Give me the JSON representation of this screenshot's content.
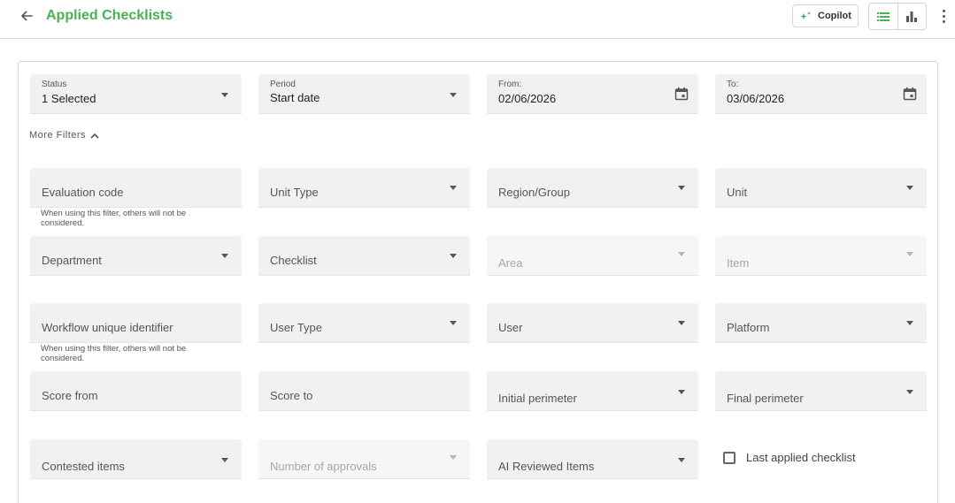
{
  "header": {
    "title": "Applied Checklists",
    "copilot_label": "Copilot"
  },
  "filters": {
    "status": {
      "label": "Status",
      "value": "1 Selected"
    },
    "period": {
      "label": "Period",
      "value": "Start date"
    },
    "from": {
      "label": "From:",
      "value": "02/06/2026"
    },
    "to": {
      "label": "To:",
      "value": "03/06/2026"
    },
    "more_filters_label": "More Filters",
    "helper_text": "When using this filter, others will not be considered.",
    "evaluation_code": "Evaluation code",
    "unit_type": "Unit Type",
    "region_group": "Region/Group",
    "unit": "Unit",
    "department": "Department",
    "checklist": "Checklist",
    "area": "Area",
    "item": "Item",
    "workflow_id": "Workflow unique identifier",
    "user_type": "User Type",
    "user": "User",
    "platform": "Platform",
    "score_from": "Score from",
    "score_to": "Score to",
    "initial_perimeter": "Initial perimeter",
    "final_perimeter": "Final perimeter",
    "contested_items": "Contested items",
    "number_of_approvals": "Number of approvals",
    "ai_reviewed_items": "AI Reviewed Items",
    "last_applied_checklist": "Last applied checklist"
  },
  "colors": {
    "accent": "#4caf50",
    "field_bg": "#f1f1f1"
  },
  "icons": {
    "back": "arrow-left-icon",
    "copilot": "sparkle-icon",
    "list_view": "list-icon",
    "chart_view": "bar-chart-icon",
    "more": "more-vertical-icon",
    "calendar": "calendar-icon"
  }
}
